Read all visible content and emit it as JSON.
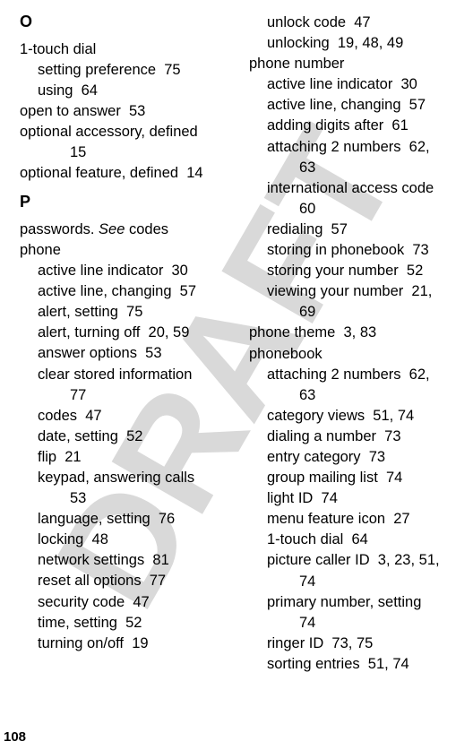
{
  "page_number": "108",
  "watermark": "DRAFT",
  "left_column": [
    {
      "type": "letter",
      "text": "O"
    },
    {
      "type": "line",
      "indent": 0,
      "text": "1-touch dial"
    },
    {
      "type": "line",
      "indent": 1,
      "text": "setting preference  75"
    },
    {
      "type": "line",
      "indent": 1,
      "text": "using  64"
    },
    {
      "type": "line",
      "indent": 0,
      "text": "open to answer  53"
    },
    {
      "type": "line",
      "indent": 0,
      "text": "optional accessory, defined"
    },
    {
      "type": "line",
      "indent": 2,
      "text": "15"
    },
    {
      "type": "line",
      "indent": 0,
      "text": "optional feature, defined  14"
    },
    {
      "type": "gap"
    },
    {
      "type": "letter",
      "text": "P"
    },
    {
      "type": "line",
      "indent": 0,
      "text_parts": [
        {
          "text": "passwords. "
        },
        {
          "text": "See",
          "italic": true
        },
        {
          "text": " codes"
        }
      ]
    },
    {
      "type": "line",
      "indent": 0,
      "text": "phone"
    },
    {
      "type": "line",
      "indent": 1,
      "text": "active line indicator  30"
    },
    {
      "type": "line",
      "indent": 1,
      "text": "active line, changing  57"
    },
    {
      "type": "line",
      "indent": 1,
      "text": "alert, setting  75"
    },
    {
      "type": "line",
      "indent": 1,
      "text": "alert, turning off  20, 59"
    },
    {
      "type": "line",
      "indent": 1,
      "text": "answer options  53"
    },
    {
      "type": "line",
      "indent": 1,
      "text": "clear stored information"
    },
    {
      "type": "line",
      "indent": 2,
      "text": "77"
    },
    {
      "type": "line",
      "indent": 1,
      "text": "codes  47"
    },
    {
      "type": "line",
      "indent": 1,
      "text": "date, setting  52"
    },
    {
      "type": "line",
      "indent": 1,
      "text": "flip  21"
    },
    {
      "type": "line",
      "indent": 1,
      "text": "keypad, answering calls"
    },
    {
      "type": "line",
      "indent": 2,
      "text": "53"
    },
    {
      "type": "line",
      "indent": 1,
      "text": "language, setting  76"
    },
    {
      "type": "line",
      "indent": 1,
      "text": "locking  48"
    },
    {
      "type": "line",
      "indent": 1,
      "text": "network settings  81"
    },
    {
      "type": "line",
      "indent": 1,
      "text": "reset all options  77"
    },
    {
      "type": "line",
      "indent": 1,
      "text": "security code  47"
    },
    {
      "type": "line",
      "indent": 1,
      "text": "time, setting  52"
    },
    {
      "type": "line",
      "indent": 1,
      "text": "turning on/off  19"
    }
  ],
  "right_column": [
    {
      "type": "line",
      "indent": 1,
      "text": "unlock code  47"
    },
    {
      "type": "line",
      "indent": 1,
      "text": "unlocking  19, 48, 49"
    },
    {
      "type": "line",
      "indent": 0,
      "text": "phone number"
    },
    {
      "type": "line",
      "indent": 1,
      "text": "active line indicator  30"
    },
    {
      "type": "line",
      "indent": 1,
      "text": "active line, changing  57"
    },
    {
      "type": "line",
      "indent": 1,
      "text": "adding digits after  61"
    },
    {
      "type": "line",
      "indent": 1,
      "text": "attaching 2 numbers  62,"
    },
    {
      "type": "line",
      "indent": 2,
      "text": "63"
    },
    {
      "type": "line",
      "indent": 1,
      "text": "international access code"
    },
    {
      "type": "line",
      "indent": 2,
      "text": "60"
    },
    {
      "type": "line",
      "indent": 1,
      "text": "redialing  57"
    },
    {
      "type": "line",
      "indent": 1,
      "text": "storing in phonebook  73"
    },
    {
      "type": "line",
      "indent": 1,
      "text": "storing your number  52"
    },
    {
      "type": "line",
      "indent": 1,
      "text": "viewing your number  21,"
    },
    {
      "type": "line",
      "indent": 2,
      "text": "69"
    },
    {
      "type": "line",
      "indent": 0,
      "text": "phone theme  3, 83"
    },
    {
      "type": "line",
      "indent": 0,
      "text": "phonebook"
    },
    {
      "type": "line",
      "indent": 1,
      "text": "attaching 2 numbers  62,"
    },
    {
      "type": "line",
      "indent": 2,
      "text": "63"
    },
    {
      "type": "line",
      "indent": 1,
      "text": "category views  51, 74"
    },
    {
      "type": "line",
      "indent": 1,
      "text": "dialing a number  73"
    },
    {
      "type": "line",
      "indent": 1,
      "text": "entry category  73"
    },
    {
      "type": "line",
      "indent": 1,
      "text": "group mailing list  74"
    },
    {
      "type": "line",
      "indent": 1,
      "text": "light ID  74"
    },
    {
      "type": "line",
      "indent": 1,
      "text": "menu feature icon  27"
    },
    {
      "type": "line",
      "indent": 1,
      "text": "1-touch dial  64"
    },
    {
      "type": "line",
      "indent": 1,
      "text": "picture caller ID  3, 23, 51,"
    },
    {
      "type": "line",
      "indent": 2,
      "text": "74"
    },
    {
      "type": "line",
      "indent": 1,
      "text": "primary number, setting"
    },
    {
      "type": "line",
      "indent": 2,
      "text": "74"
    },
    {
      "type": "line",
      "indent": 1,
      "text": "ringer ID  73, 75"
    },
    {
      "type": "line",
      "indent": 1,
      "text": "sorting entries  51, 74"
    }
  ]
}
